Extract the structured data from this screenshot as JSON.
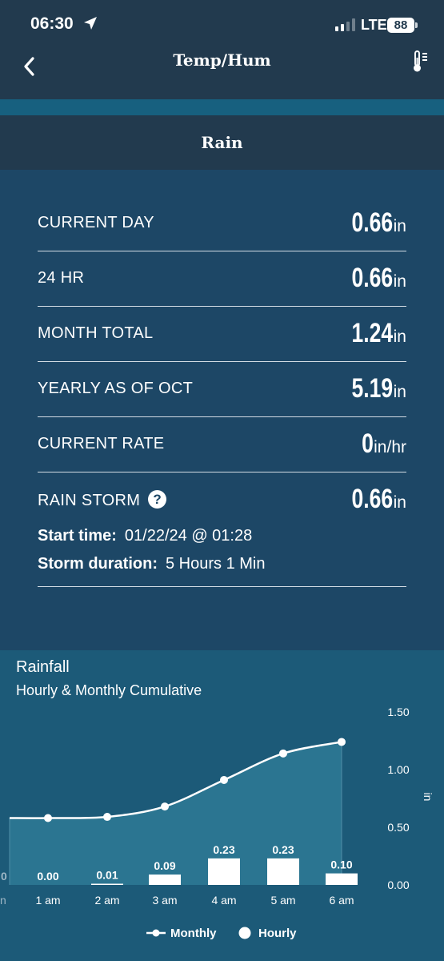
{
  "status": {
    "time": "06:30",
    "network": "LTE",
    "battery": "88"
  },
  "nav": {
    "title": "Temp/Hum",
    "back_icon": "chevron-left-icon",
    "right_icon": "thermometer-list-icon"
  },
  "section": {
    "title": "Rain"
  },
  "stats": {
    "current_day": {
      "label": "CURRENT DAY",
      "value": "0.66",
      "unit": "in"
    },
    "hr24": {
      "label": "24 HR",
      "value": "0.66",
      "unit": "in"
    },
    "month_total": {
      "label": "MONTH TOTAL",
      "value": "1.24",
      "unit": "in"
    },
    "yearly": {
      "label": "YEARLY AS OF OCT",
      "value": "5.19",
      "unit": "in"
    },
    "current_rate": {
      "label": "CURRENT RATE",
      "value": "0",
      "unit": "in/hr"
    },
    "rain_storm": {
      "label": "RAIN STORM",
      "help": "?",
      "value": "0.66",
      "unit": "in"
    },
    "storm_start": {
      "label": "Start time:",
      "value": "01/22/24 @ 01:28"
    },
    "storm_duration": {
      "label": "Storm duration:",
      "value": "5 Hours 1 Min"
    }
  },
  "chart": {
    "title": "Rainfall",
    "subtitle": "Hourly & Monthly Cumulative"
  },
  "chart_data": {
    "type": "bar",
    "categories": [
      "1 am",
      "2 am",
      "3 am",
      "4 am",
      "5 am",
      "6 am"
    ],
    "series": [
      {
        "name": "Hourly",
        "type": "bar",
        "values": [
          0.0,
          0.01,
          0.09,
          0.23,
          0.23,
          0.1
        ],
        "labels": [
          "0.00",
          "0.01",
          "0.09",
          "0.23",
          "0.23",
          "0.10"
        ]
      },
      {
        "name": "Monthly",
        "type": "area",
        "values": [
          0.58,
          0.59,
          0.68,
          0.91,
          1.14,
          1.24
        ]
      }
    ],
    "partial_left": {
      "tick": "n",
      "label": "0"
    },
    "yticks": [
      "1.50",
      "1.00",
      "0.50",
      "0.00"
    ],
    "ylabel": "in",
    "ylim": [
      0,
      1.5
    ],
    "legend_position": "bottom",
    "colors": {
      "area": "#2b7591",
      "line": "#ffffff",
      "bars": "#ffffff",
      "panel": "#1c5a78"
    }
  }
}
